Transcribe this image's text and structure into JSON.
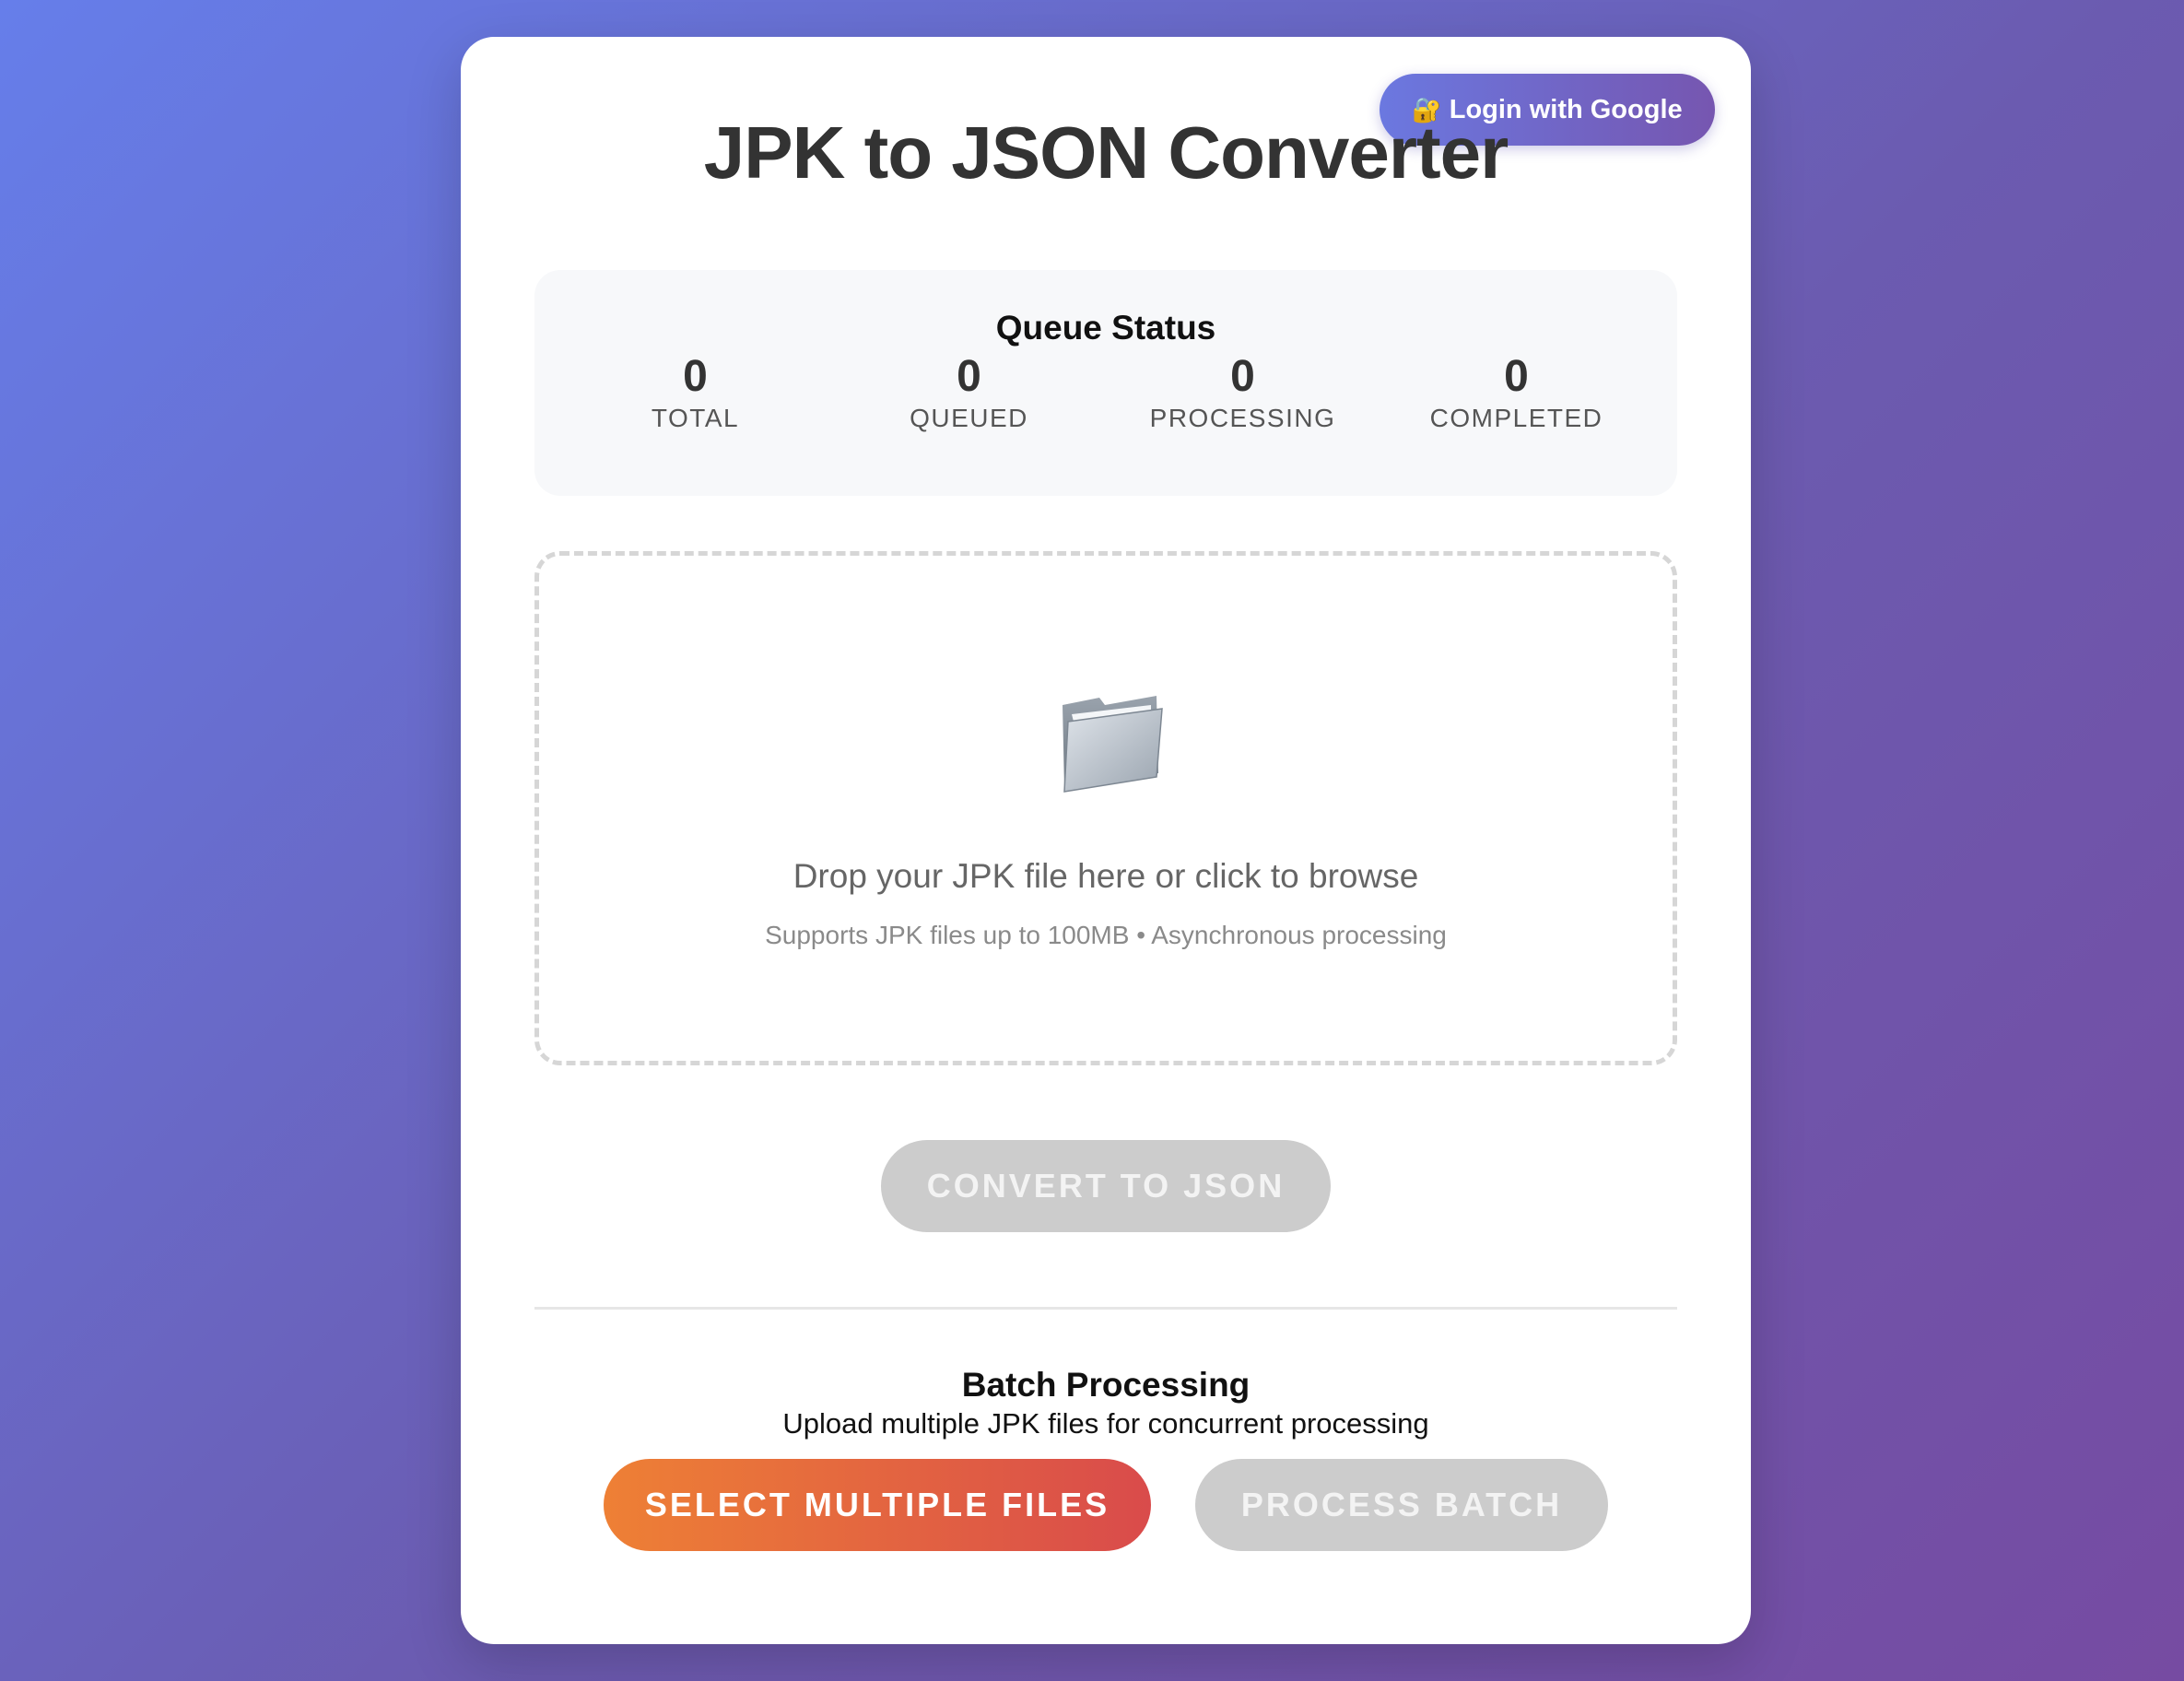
{
  "header": {
    "title": "JPK to JSON Converter",
    "login_icon": "lock-key-icon",
    "login_label": "Login with Google"
  },
  "queue": {
    "title": "Queue Status",
    "stats": [
      {
        "value": "0",
        "label": "TOTAL"
      },
      {
        "value": "0",
        "label": "QUEUED"
      },
      {
        "value": "0",
        "label": "PROCESSING"
      },
      {
        "value": "0",
        "label": "COMPLETED"
      }
    ]
  },
  "dropzone": {
    "icon": "folder-icon",
    "text": "Drop your JPK file here or click to browse",
    "subtext": "Supports JPK files up to 100MB • Asynchronous processing"
  },
  "convert": {
    "label": "CONVERT TO JSON",
    "disabled": true
  },
  "batch": {
    "title": "Batch Processing",
    "subtitle": "Upload multiple JPK files for concurrent processing",
    "select_label": "SELECT MULTIPLE FILES",
    "process_label": "PROCESS BATCH",
    "process_disabled": true
  },
  "colors": {
    "background_start": "#667eea",
    "background_end": "#764ba2",
    "accent_orange": "#ee8035",
    "accent_red": "#d94b4b",
    "disabled_gray": "#cccccc"
  }
}
